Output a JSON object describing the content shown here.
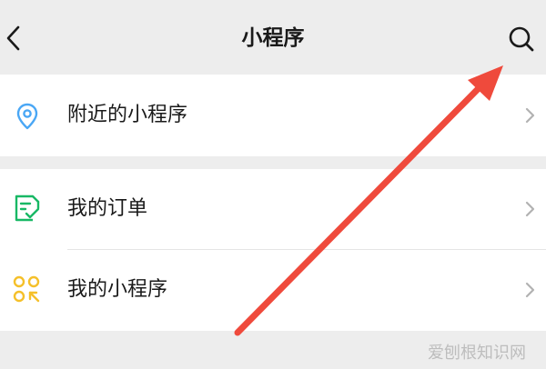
{
  "nav": {
    "title": "小程序",
    "back_icon": "chevron-left-icon",
    "search_icon": "search-icon"
  },
  "groups": [
    {
      "items": [
        {
          "label": "附近的小程序",
          "icon": "location-pin-icon",
          "icon_color": "#4aa7f5"
        }
      ]
    },
    {
      "items": [
        {
          "label": "我的订单",
          "icon": "order-checklist-icon",
          "icon_color": "#18b865"
        },
        {
          "label": "我的小程序",
          "icon": "mini-programs-grid-icon",
          "icon_color": "#f5c02a"
        }
      ]
    }
  ],
  "watermark": "爱刨根知识网",
  "colors": {
    "background": "#ededed",
    "cell_background": "#ffffff",
    "annotation_arrow": "#ef4a3c",
    "chevron": "#b2b2b2"
  }
}
